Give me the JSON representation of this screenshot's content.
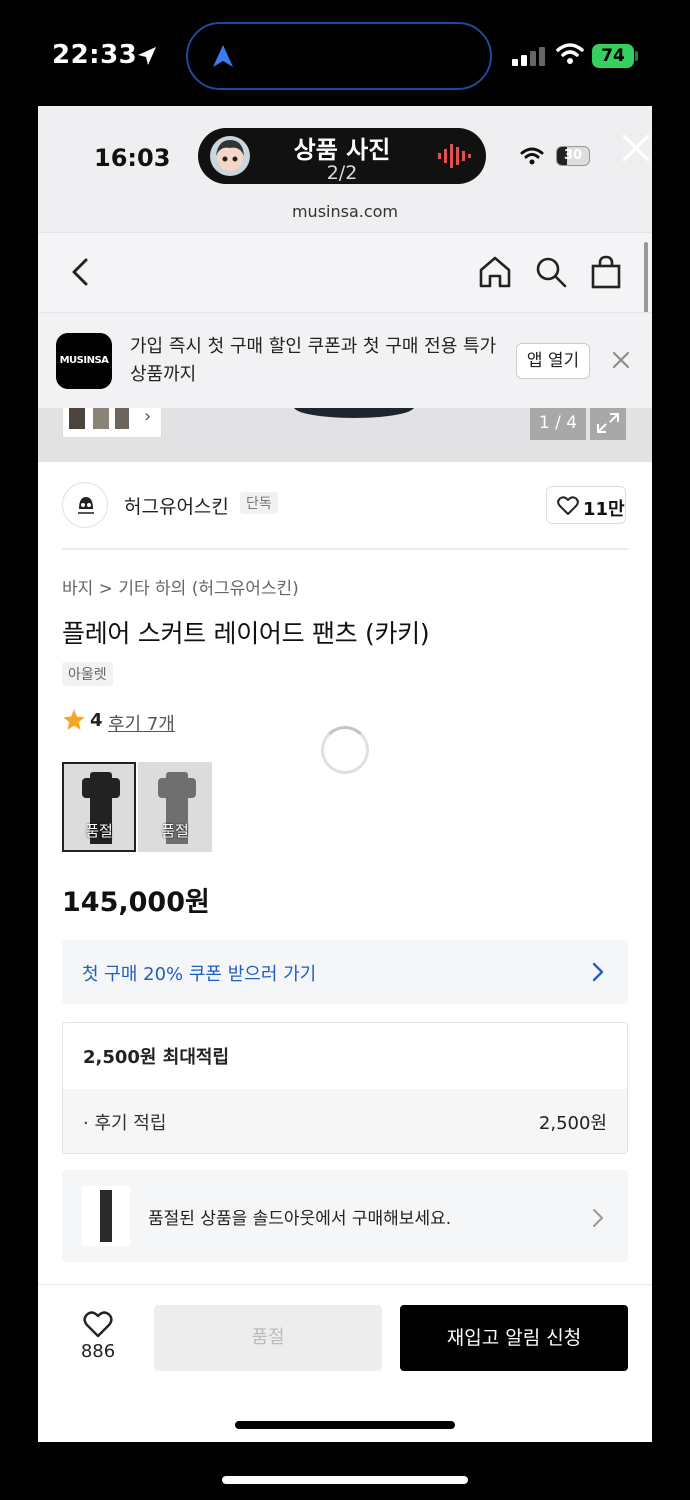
{
  "device_status": {
    "time": "22:33",
    "battery": "74"
  },
  "viewer": {
    "time": "16:03",
    "photo_title": "상품 사진",
    "photo_count": "2/2",
    "battery": "30",
    "domain": "musinsa.com"
  },
  "app_banner": {
    "logo": "MUSINSA",
    "text": "가입 즉시 첫 구매 할인 쿠폰과 첫 구매 전용 특가 상품까지",
    "open_app": "앱 열기"
  },
  "hero": {
    "counter": "1 / 4"
  },
  "brand": {
    "name": "허그유어스킨",
    "tag": "단독",
    "likes": "11만"
  },
  "product": {
    "breadcrumb": "바지 > 기타 하의 (허그유어스킨)",
    "title": "플레어 스커트 레이어드 팬츠 (카키)",
    "tag": "아울렛",
    "rating": "4",
    "reviews": "후기 7개",
    "options": [
      {
        "label": "품절"
      },
      {
        "label": "품절"
      }
    ],
    "price": "145,000원"
  },
  "coupon": {
    "text": "첫 구매 20% 쿠폰 받으러 가기"
  },
  "points": {
    "header": "2,500원 최대적립",
    "item_label": "· 후기 적립",
    "item_value": "2,500원"
  },
  "soldout_banner": {
    "text": "품절된 상품을 솔드아웃에서 구매해보세요."
  },
  "bottom_bar": {
    "wish_count": "886",
    "soldout_label": "품절",
    "restock_label": "재입고 알림 신청"
  },
  "colors": {
    "accent_blue": "#1f5fc4",
    "battery_green": "#35d05d",
    "star": "#f5a623"
  }
}
